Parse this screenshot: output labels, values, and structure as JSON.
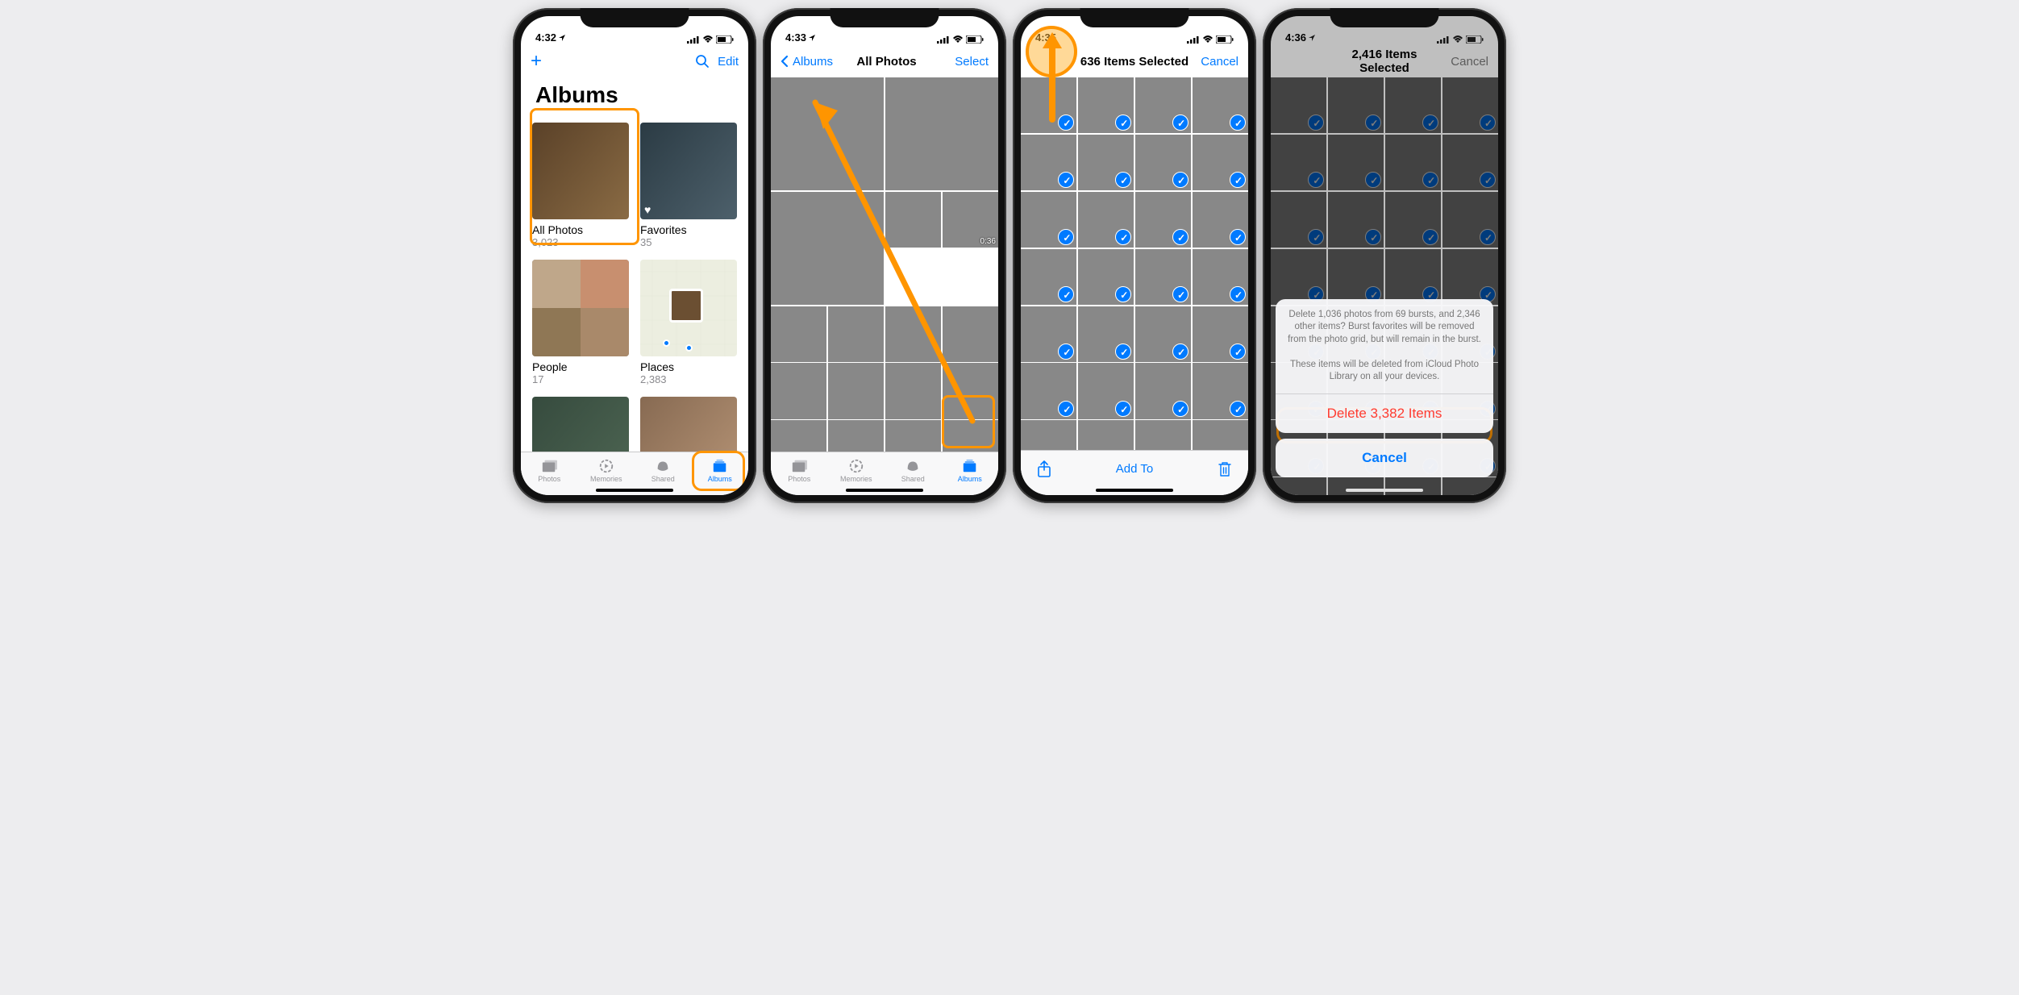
{
  "panel1": {
    "time": "4:32",
    "add_label": "+",
    "edit_label": "Edit",
    "title": "Albums",
    "albums": [
      {
        "name": "All Photos",
        "count": "3,023"
      },
      {
        "name": "Favorites",
        "count": "35"
      },
      {
        "name": "People",
        "count": "17"
      },
      {
        "name": "Places",
        "count": "2,383"
      }
    ],
    "tabs": [
      "Photos",
      "Memories",
      "Shared",
      "Albums"
    ]
  },
  "panel2": {
    "time": "4:33",
    "back_label": "Albums",
    "title": "All Photos",
    "select_label": "Select",
    "video_duration": "0:36",
    "tabs": [
      "Photos",
      "Memories",
      "Shared",
      "Albums"
    ]
  },
  "panel3": {
    "time": "4:35",
    "title": "636 Items Selected",
    "cancel_label": "Cancel",
    "addto_label": "Add To"
  },
  "panel4": {
    "time": "4:36",
    "title": "2,416 Items Selected",
    "cancel_label": "Cancel",
    "sheet_msg1": "Delete 1,036 photos from 69 bursts, and 2,346 other items? Burst favorites will be removed from the photo grid, but will remain in the burst.",
    "sheet_msg2": "These items will be deleted from iCloud Photo Library on all your devices.",
    "delete_label": "Delete 3,382 Items",
    "sheet_cancel": "Cancel"
  }
}
